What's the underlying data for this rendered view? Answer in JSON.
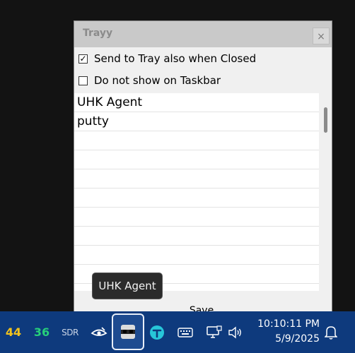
{
  "window": {
    "title": "Trayy",
    "close_glyph": "×"
  },
  "options": {
    "send_to_tray": {
      "label": "Send to Tray also when Closed",
      "checked": true,
      "check_glyph": "✓"
    },
    "hide_taskbar": {
      "label": "Do not show on Taskbar",
      "checked": false
    }
  },
  "apps_list": [
    "UHK Agent",
    "putty",
    "",
    "",
    "",
    "",
    "",
    "",
    "",
    "",
    ""
  ],
  "buttons": {
    "save": "Save"
  },
  "tooltip": "UHK Agent",
  "taskbar": {
    "tray_value_1": "44",
    "tray_value_2": "36",
    "sdr_label": "SDR",
    "time": "10:10:11 PM",
    "date": "5/9/2025"
  },
  "colors": {
    "taskbar_bg": "#0e3a7d",
    "yellow_value": "#f2c21c",
    "green_value": "#27d07a",
    "title_bar": "#c9c9c9"
  }
}
